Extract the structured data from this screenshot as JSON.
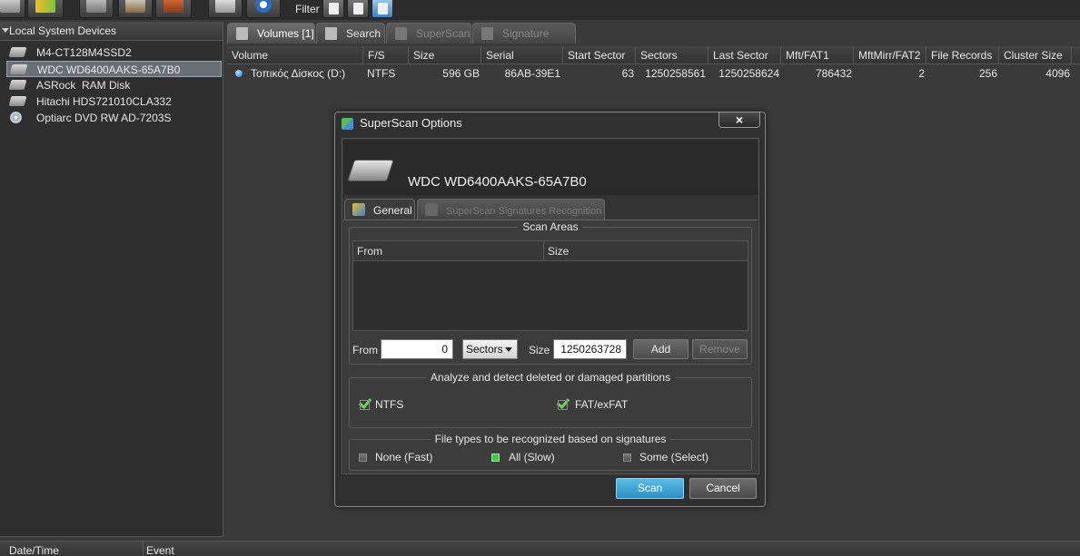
{
  "toolbar": {
    "filter_label": "Filter"
  },
  "left_panel": {
    "header": "Local System Devices",
    "devices": [
      {
        "label": "M4-CT128M4SSD2",
        "icon": "hard-drive-icon"
      },
      {
        "label": "WDC WD6400AAKS-65A7B0",
        "icon": "hard-drive-icon",
        "selected": true
      },
      {
        "label": "ASRock  RAM Disk",
        "icon": "hard-drive-icon"
      },
      {
        "label": "Hitachi HDS721010CLA332",
        "icon": "hard-drive-icon"
      },
      {
        "label": "Optiarc DVD RW AD-7203S",
        "icon": "optical-drive-icon"
      }
    ]
  },
  "tabs": [
    {
      "label": "Volumes [1]",
      "active": true
    },
    {
      "label": "Search"
    },
    {
      "label": "SuperScan",
      "disabled": true
    },
    {
      "label": "Signature Files",
      "disabled": true
    }
  ],
  "volumes_table": {
    "columns": [
      "Volume",
      "F/S",
      "Size",
      "Serial",
      "Start Sector",
      "Sectors",
      "Last Sector",
      "Mft/FAT1",
      "MftMirr/FAT2",
      "File Records",
      "Cluster Size"
    ],
    "rows": [
      {
        "volume": "Τοπικός Δίσκος (D:)",
        "fs": "NTFS",
        "size": "596 GB",
        "serial": "86AB-39E1",
        "start_sector": "63",
        "sectors": "1250258561",
        "last_sector": "1250258624",
        "mft_fat1": "786432",
        "mftmirr_fat2": "2",
        "file_records": "256",
        "cluster_size": "4096"
      }
    ]
  },
  "bottom_log": {
    "columns": [
      "Date/Time",
      "Event"
    ]
  },
  "dialog": {
    "title": "SuperScan Options",
    "close_label": "×",
    "drive_name": "WDC WD6400AAKS-65A7B0",
    "tabs": [
      {
        "label": "General",
        "active": true
      },
      {
        "label": "SuperScan Signatures Recognition",
        "disabled": true
      }
    ],
    "scan_areas": {
      "title": "Scan Areas",
      "columns": [
        "From",
        "Size"
      ],
      "from_label": "From",
      "from_value": "0",
      "unit_select": "Sectors",
      "size_label": "Size",
      "size_value": "1250263728",
      "add_label": "Add",
      "remove_label": "Remove"
    },
    "partitions": {
      "title": "Analyze and detect deleted or damaged partitions",
      "ntfs_label": "NTFS",
      "ntfs_checked": true,
      "fat_label": "FAT/exFAT",
      "fat_checked": true
    },
    "file_types": {
      "title": "File types to be recognized based on signatures",
      "options": [
        {
          "label": "None (Fast)",
          "selected": false
        },
        {
          "label": "All (Slow)",
          "selected": true
        },
        {
          "label": "Some (Select)",
          "selected": false
        }
      ]
    },
    "scan_label": "Scan",
    "cancel_label": "Cancel"
  },
  "colors": {
    "accent": "#2a8fc2",
    "check_green": "#6bd35a",
    "background": "#3a3a3a"
  }
}
